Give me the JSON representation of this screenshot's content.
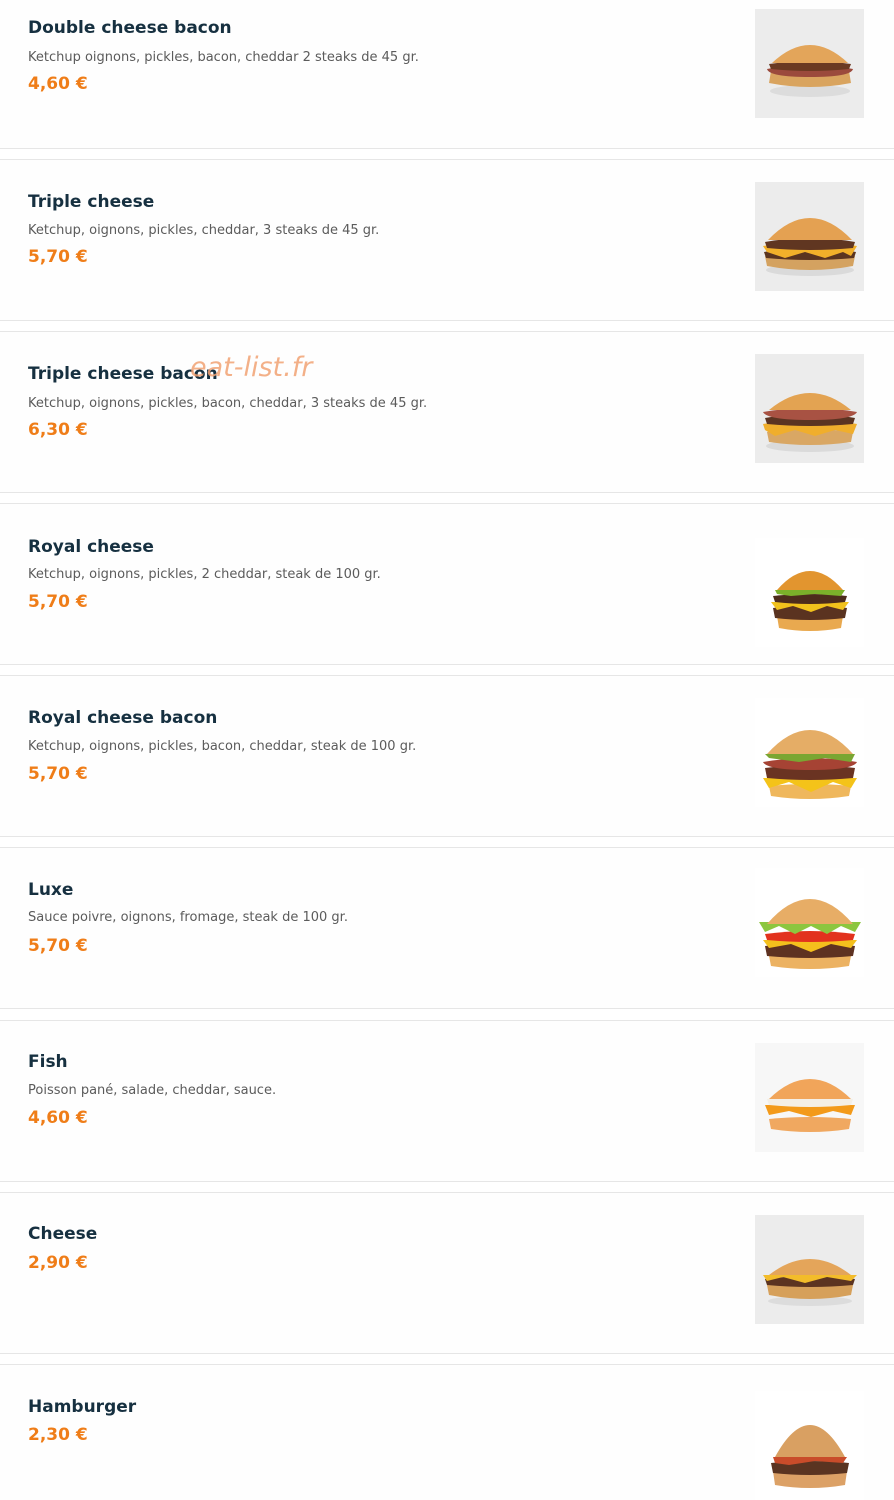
{
  "watermark": "eat-list.fr",
  "items": [
    {
      "name": "Double cheese bacon",
      "description": "Ketchup oignons, pickles, bacon, cheddar 2 steaks de 45 gr.",
      "price": "4,60 €",
      "image": "burger-bacon-photo"
    },
    {
      "name": "Triple cheese",
      "description": "Ketchup, oignons, pickles, cheddar, 3 steaks de 45 gr.",
      "price": "5,70 €",
      "image": "burger-triple-cheese-photo"
    },
    {
      "name": "Triple cheese bacon",
      "description": "Ketchup, oignons, pickles, bacon, cheddar, 3 steaks de 45 gr.",
      "price": "6,30 €",
      "image": "burger-triple-bacon-photo"
    },
    {
      "name": "Royal cheese",
      "description": "Ketchup, oignons, pickles, 2 cheddar, steak de 100 gr.",
      "price": "5,70 €",
      "image": "burger-royal-cheese-photo"
    },
    {
      "name": "Royal cheese bacon",
      "description": "Ketchup, oignons, pickles, bacon, cheddar, steak de 100 gr.",
      "price": "5,70 €",
      "image": "burger-royal-bacon-photo"
    },
    {
      "name": "Luxe",
      "description": "Sauce poivre, oignons, fromage, steak de 100 gr.",
      "price": "5,70 €",
      "image": "burger-luxe-photo"
    },
    {
      "name": "Fish",
      "description": "Poisson pané, salade, cheddar, sauce.",
      "price": "4,60 €",
      "image": "burger-fish-photo"
    },
    {
      "name": "Cheese",
      "description": "",
      "price": "2,90 €",
      "image": "burger-cheese-photo"
    },
    {
      "name": "Hamburger",
      "description": "",
      "price": "2,30 €",
      "image": "burger-hamburger-photo"
    }
  ]
}
